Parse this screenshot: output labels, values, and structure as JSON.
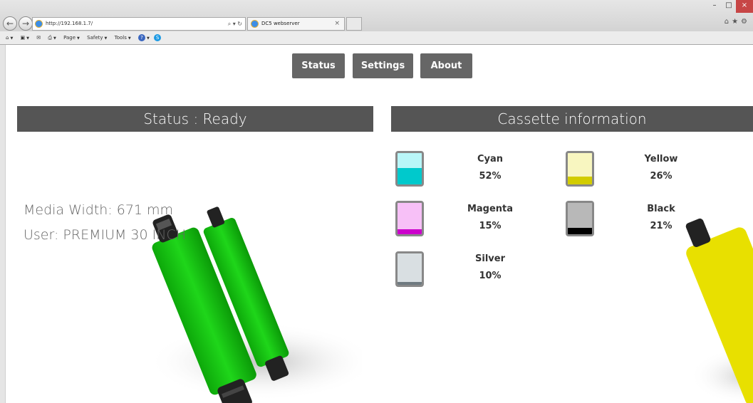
{
  "browser": {
    "url": "http://192.168.1.7/",
    "tab_title": "DC5 webserver",
    "tab_close": "×",
    "search_glyph": "⌕ ▾ ↻",
    "command_bar": {
      "page_label": "Page",
      "safety_label": "Safety",
      "tools_label": "Tools"
    },
    "window_controls": {
      "minimize": "–",
      "maximize": "□",
      "close": "×"
    },
    "right_icons": "⌂★⚙"
  },
  "nav": {
    "status_label": "Status",
    "settings_label": "Settings",
    "about_label": "About"
  },
  "status_panel": {
    "title": "Status : Ready",
    "media_width": "Media Width: 671 mm",
    "user": "User: PREMIUM 30 INCH"
  },
  "cassette_panel": {
    "title": "Cassette information",
    "inks": [
      {
        "name": "Cyan",
        "percent_label": "52%",
        "level": 0.52,
        "color": "#00c9cc",
        "bg": "#b9f6f8"
      },
      {
        "name": "Yellow",
        "percent_label": "26%",
        "level": 0.26,
        "color": "#d2cc00",
        "bg": "#f8f6c0"
      },
      {
        "name": "Magenta",
        "percent_label": "15%",
        "level": 0.15,
        "color": "#cc00cc",
        "bg": "#f7c0f7"
      },
      {
        "name": "Black",
        "percent_label": "21%",
        "level": 0.21,
        "color": "#000000",
        "bg": "#b8b8b8"
      },
      {
        "name": "Silver",
        "percent_label": "10%",
        "level": 0.1,
        "color": "#6f7a80",
        "bg": "#d9dfe2"
      }
    ]
  },
  "colors": {
    "nav_bg": "#666666",
    "panel_header_bg": "#555555",
    "ribbon_green": "#18c214",
    "ribbon_yellow": "#e8e000"
  }
}
